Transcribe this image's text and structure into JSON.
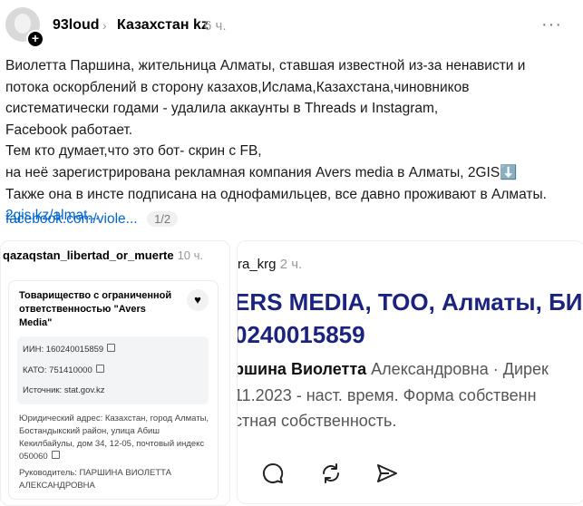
{
  "post": {
    "username": "93loud",
    "community": "Казахстан kz",
    "time": "6 ч.",
    "more_label": "···",
    "lines": [
      "Виолетта Паршина, жительница Алматы, ставшая известной из-за ненависти и",
      "потока оскорблений в сторону казахов,Ислама,Казахстана,чиновников",
      "систематически годами - удалила аккаунты в Threads и Instagram,",
      "Facebook работает.",
      "Тем кто думает,что это бот- скрин с FB,",
      "на неё зарегистрирована рекламная компания Avers media в Алматы, 2GIS⬇️",
      "Также она в инсте подписана на однофамильцев, все давно проживают в Алматы."
    ],
    "link1": "2gis.kz/almat...",
    "link2": "facebook.com/viole...",
    "page_indicator": "1/2"
  },
  "left_card": {
    "username": "qazaqstan_libertad_or_muerte",
    "time": "10 ч.",
    "company": "Товарищество с ограниченной ответственностью \"Avers Media\"",
    "inn": "ИИН: 160240015859",
    "kato": "КАТО: 751410000",
    "source": "Источник: stat.gov.kz",
    "address": "Юридический адрес: Казахстан, город Алматы, Бостандыкский район, улица Абиш Кекилбайулы, дом 34, 12-05, почтовый индекс 050060",
    "head": "Руководитель: ПАРШИНА ВИОЛЕТТА АЛЕКСАНДРОВНА"
  },
  "right_card": {
    "username": "ra_krg",
    "time": "2 ч.",
    "line1": "ERS MEDIA, ТОО, Алматы, БИН",
    "line2": "0240015859",
    "line3_bold": "ршина Виолетта",
    "line3_rest": " Александровна · Дирек",
    "line4": "11.2023 - наст. время. Форма собственн",
    "line5": "стная собственность."
  }
}
